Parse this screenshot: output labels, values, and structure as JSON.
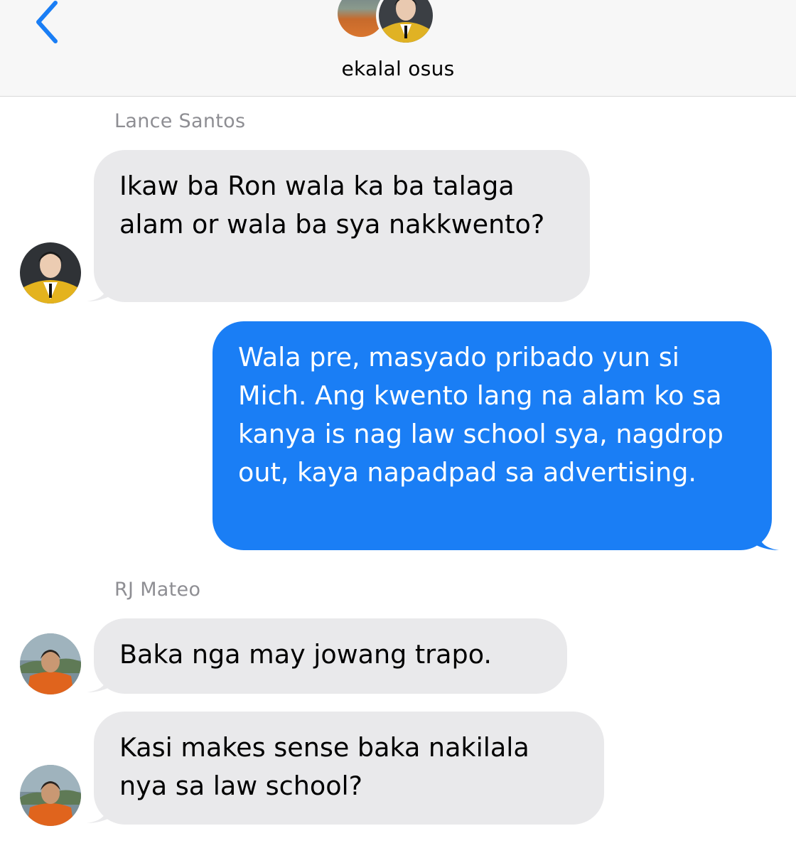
{
  "header": {
    "back_icon": "chevron-left-icon",
    "title": "ekalal osus",
    "accent_color": "#1a7ef5"
  },
  "messages": [
    {
      "sender": "Lance Santos",
      "direction": "incoming",
      "text": "Ikaw ba Ron wala ka ba talaga alam or wala ba sya nakkwento?"
    },
    {
      "sender": "",
      "direction": "outgoing",
      "text": "Wala pre, masyado pribado yun si Mich. Ang kwento lang na alam ko sa kanya is nag law school sya, nagdrop out, kaya napadpad sa advertising."
    },
    {
      "sender": "RJ Mateo",
      "direction": "incoming",
      "text": "Baka nga may jowang trapo."
    },
    {
      "sender": "RJ Mateo",
      "direction": "incoming",
      "text": "Kasi makes sense baka nakilala nya sa law school?"
    }
  ],
  "colors": {
    "incoming_bubble": "#e9e9eb",
    "outgoing_bubble": "#1a7ef5",
    "sender_name": "#8e8e93",
    "header_bg": "#f7f7f7"
  }
}
